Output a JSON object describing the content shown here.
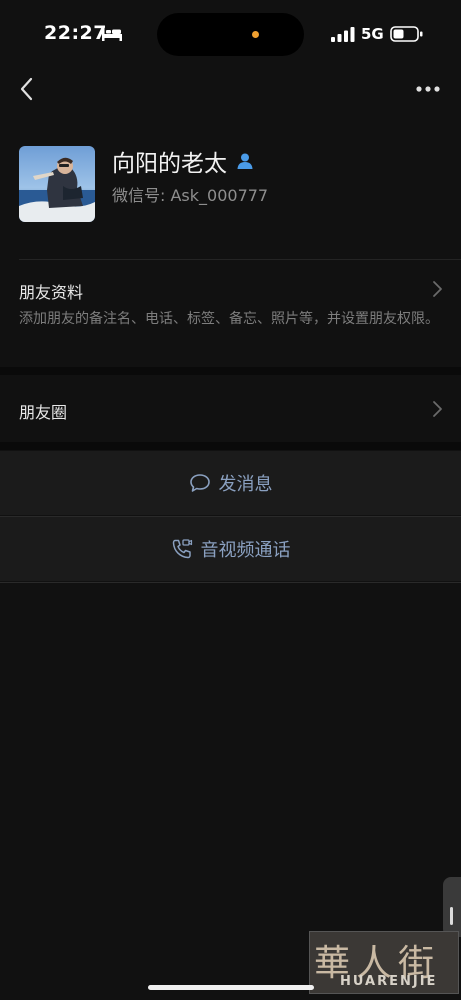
{
  "status": {
    "time": "22:27",
    "network": "5G"
  },
  "nav": {
    "back_icon": "chevron-left-icon",
    "more_icon": "more-horizontal-icon"
  },
  "profile": {
    "name": "向阳的老太",
    "id_label": "微信号: ",
    "id_value": "Ask_000777",
    "badge_icon": "person-icon",
    "accent_color": "#4a9be8"
  },
  "friend_info": {
    "title": "朋友资料",
    "desc": "添加朋友的备注名、电话、标签、备忘、照片等，并设置朋友权限。"
  },
  "moments": {
    "title": "朋友圈"
  },
  "actions": {
    "message": "发消息",
    "call": "音视频通话"
  },
  "watermark": {
    "chars": "華人街",
    "sub": "HUARENJIE"
  }
}
